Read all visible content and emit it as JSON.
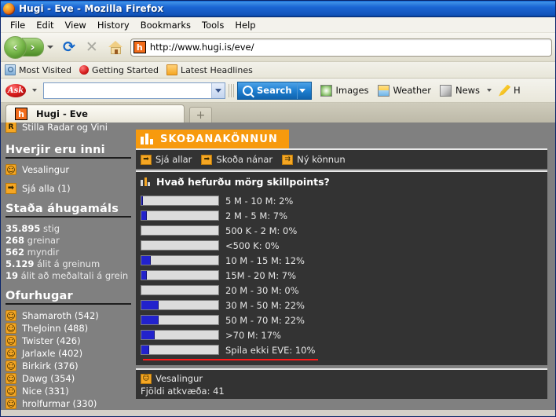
{
  "window": {
    "title": "Hugi - Eve - Mozilla Firefox"
  },
  "menu": {
    "items": [
      "File",
      "Edit",
      "View",
      "History",
      "Bookmarks",
      "Tools",
      "Help"
    ]
  },
  "navbar": {
    "back_glyph": "‹",
    "forward_glyph": "›",
    "reload_glyph": "⟳",
    "stop_glyph": "✕",
    "favicon_text": "h",
    "url": "http://www.hugi.is/eve/"
  },
  "bookmarks": {
    "items": [
      "Most Visited",
      "Getting Started",
      "Latest Headlines"
    ]
  },
  "ask_toolbar": {
    "logo_text": "Ask",
    "search_value": "",
    "search_button": "Search",
    "items": [
      "Images",
      "Weather",
      "News"
    ],
    "trailing_text": "H"
  },
  "tabs": {
    "active": {
      "favicon": "h",
      "label": "Hugi - Eve"
    },
    "new_tab_glyph": "+"
  },
  "sidebar": {
    "cut_item": {
      "icon_text": "R",
      "label": "Stilla Radar og Vini"
    },
    "section_online": {
      "heading": "Hverjir eru inni",
      "items": [
        {
          "label": "Vesalingur",
          "icon": "smiley-icon"
        },
        {
          "label": "Sjá alla (1)",
          "icon": "arrow-icon"
        }
      ]
    },
    "section_stats": {
      "heading": "Staða áhugamáls",
      "lines": [
        {
          "value": "35.895",
          "label": "stig"
        },
        {
          "value": "268",
          "label": "greinar"
        },
        {
          "value": "562",
          "label": "myndir"
        },
        {
          "value": "5.129",
          "label": "álit á greinum"
        },
        {
          "value": "19",
          "label": "álit að meðaltali á grein"
        }
      ]
    },
    "section_top": {
      "heading": "Ofurhugar",
      "items": [
        "Shamaroth (542)",
        "TheJoinn (488)",
        "Twister (426)",
        "Jarlaxle (402)",
        "Birkirk (376)",
        "Dawg (354)",
        "Nice (331)",
        "hrolfurmar (330)"
      ]
    }
  },
  "main": {
    "banner": "SKOÐANAKÖNNUN",
    "links": [
      {
        "label": "Sjá allar",
        "icon": "arrow-box-icon"
      },
      {
        "label": "Skoða nánar",
        "icon": "arrow-box-icon"
      },
      {
        "label": "Ný könnun",
        "icon": "new-poll-icon"
      }
    ],
    "poll_question": "Hvað hefurðu mörg skillpoints?",
    "author": "Vesalingur",
    "votes_label": "Fjöldi atkvæða: 41"
  },
  "chart_data": {
    "type": "bar",
    "title": "Hvað hefurðu mörg skillpoints?",
    "xlabel": "",
    "ylabel": "",
    "ylim": [
      0,
      100
    ],
    "unit": "%",
    "orientation": "horizontal",
    "categories": [
      "5 M - 10 M",
      "2 M - 5 M",
      "500 K - 2 M",
      "<500 K",
      "10 M - 15 M",
      "15M - 20 M",
      "20 M - 30 M",
      "30 M - 50 M",
      "50 M - 70 M",
      ">70 M",
      "Spila ekki EVE"
    ],
    "values": [
      2,
      7,
      0,
      0,
      12,
      7,
      0,
      22,
      22,
      17,
      10
    ],
    "labels": [
      "5 M - 10 M: 2%",
      "2 M - 5 M: 7%",
      "500 K - 2 M: 0%",
      "<500 K: 0%",
      "10 M - 15 M: 12%",
      "15M - 20 M: 7%",
      "20 M - 30 M: 0%",
      "30 M - 50 M: 22%",
      "50 M - 70 M: 22%",
      ">70 M: 17%",
      "Spila ekki EVE: 10%"
    ],
    "bar_color": "#2222cc",
    "track_color": "#dcdcdc",
    "total_votes": 41
  }
}
